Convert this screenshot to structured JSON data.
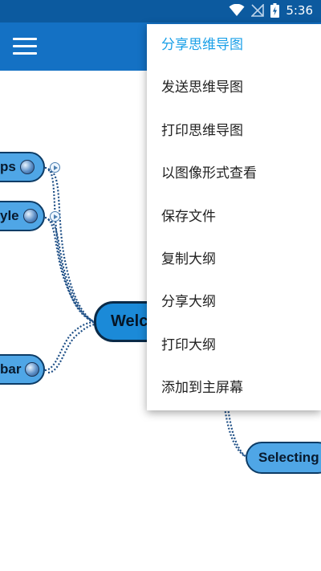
{
  "status_bar": {
    "time": "5:36"
  },
  "toolbar": {
    "menu_icon": "hamburger-icon"
  },
  "mindmap": {
    "nodes": [
      {
        "id": "node-tips",
        "text": "ps"
      },
      {
        "id": "node-style",
        "text": "yle"
      },
      {
        "id": "node-bar",
        "text": "bar"
      },
      {
        "id": "node-center",
        "text": "Welc"
      },
      {
        "id": "node-selecting",
        "text": "Selecting"
      }
    ]
  },
  "menu": {
    "items": [
      {
        "label": "分享思维导图",
        "active": true
      },
      {
        "label": "发送思维导图"
      },
      {
        "label": "打印思维导图"
      },
      {
        "label": "以图像形式查看"
      },
      {
        "label": "保存文件"
      },
      {
        "label": "复制大纲"
      },
      {
        "label": "分享大纲"
      },
      {
        "label": "打印大纲"
      },
      {
        "label": "添加到主屏幕"
      }
    ]
  },
  "colors": {
    "status_bar": "#0c5a9f",
    "toolbar": "#1471c4",
    "node_fill": "#4fa6e6",
    "center_fill": "#1b8ad8",
    "menu_active": "#1aa0e8"
  }
}
